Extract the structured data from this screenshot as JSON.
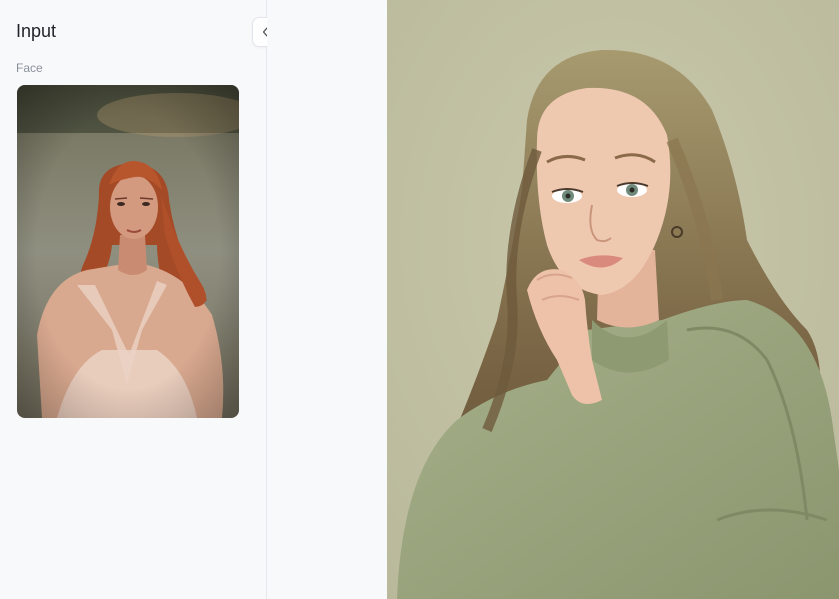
{
  "input_panel": {
    "title": "Input",
    "face_section_label": "Face",
    "collapse_icon": "double-chevron-left-icon"
  },
  "colors": {
    "panel_bg": "#f8f9fb",
    "result_bg": "#c2c1a3",
    "divider": "#e6e8ec"
  }
}
